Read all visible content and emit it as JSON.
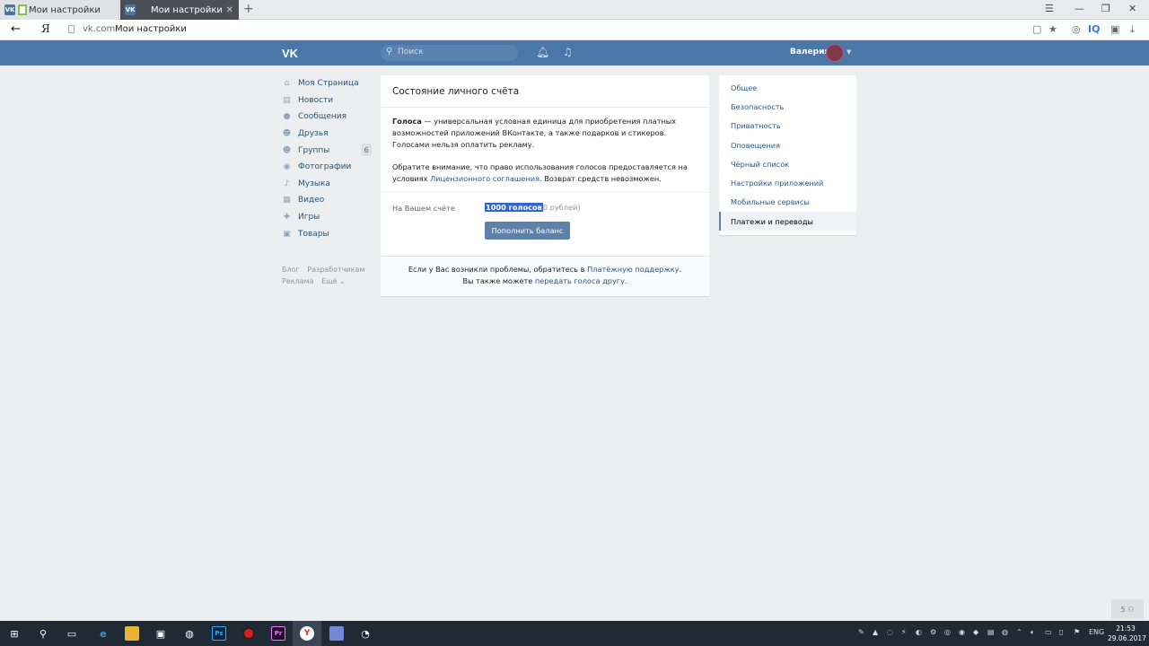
{
  "browser": {
    "tabs": [
      {
        "label": "Мои настройки",
        "favicon": "vk-favicon"
      },
      {
        "label": "Мои настройки",
        "favicon": "vk-favicon"
      }
    ],
    "close_glyph": "✕",
    "new_tab_glyph": "+",
    "address": {
      "host": "vk.com",
      "title": "Мои настройки"
    },
    "back_glyph": "←",
    "yandex_glyph": "Я",
    "iq_label": "IQ"
  },
  "header": {
    "logo": "VK",
    "search_placeholder": "Поиск",
    "user_name": "Валерия",
    "accent": "#4a76a8"
  },
  "sidebar": {
    "items": [
      {
        "label": "Моя Страница",
        "icon": "home-icon"
      },
      {
        "label": "Новости",
        "icon": "news-icon"
      },
      {
        "label": "Сообщения",
        "icon": "messages-icon"
      },
      {
        "label": "Друзья",
        "icon": "friends-icon"
      },
      {
        "label": "Группы",
        "icon": "groups-icon",
        "badge": "6"
      },
      {
        "label": "Фотографии",
        "icon": "camera-icon"
      },
      {
        "label": "Музыка",
        "icon": "music-icon"
      },
      {
        "label": "Видео",
        "icon": "video-icon"
      },
      {
        "label": "Игры",
        "icon": "games-icon"
      },
      {
        "label": "Товары",
        "icon": "market-icon"
      }
    ],
    "footer": {
      "blog": "Блог",
      "developers": "Разработчикам",
      "ads": "Реклама",
      "more": "Ещё ⌄"
    }
  },
  "main": {
    "title": "Состояние личного счёта",
    "desc1_bold": "Голоса",
    "desc1_rest": " — универсальная условная единица для приобретения платных возможностей приложений ВКонтакте, а также подарков и стикеров. Голосами нельзя оплатить рекламу.",
    "desc2_start": "Обратите внимание, что право использования голосов предоставляется на условиях ",
    "desc2_link": "Лицензионного соглашения",
    "desc2_end": ". Возврат средств невозможен.",
    "balance_label": "На Вашем счёте",
    "balance_votes": "1000 голосов",
    "balance_rub": "0 рублей)",
    "topup_button": "Пополнить баланс",
    "footer_line1_start": "Если у Вас возникли проблемы, обратитесь в ",
    "footer_line1_link": "Платёжную поддержку",
    "footer_line1_end": ".",
    "footer_line2_start": "Вы также можете ",
    "footer_line2_link": "передать голоса другу",
    "footer_line2_end": "."
  },
  "settings_menu": {
    "items": [
      {
        "label": "Общее",
        "active": false
      },
      {
        "label": "Безопасность",
        "active": false
      },
      {
        "label": "Приватность",
        "active": false
      },
      {
        "label": "Оповещения",
        "active": false
      },
      {
        "label": "Чёрный список",
        "active": false
      },
      {
        "label": "Настройки приложений",
        "active": false
      },
      {
        "label": "Мобильные сервисы",
        "active": false
      },
      {
        "label": "Платежи и переводы",
        "active": true
      }
    ]
  },
  "scroll_button": "5 ⚇",
  "taskbar": {
    "apps": [
      "windows-start-icon",
      "search-icon",
      "task-view-icon",
      "edge-icon",
      "file-explorer-icon",
      "store-icon",
      "steam-icon",
      "photoshop-icon",
      "obs-icon",
      "premiere-icon",
      "yandex-browser-icon",
      "discord-icon",
      "chrome-icon"
    ],
    "ps_label": "Ps",
    "pr_label": "Pr",
    "ya_label": "Y",
    "lang": "ENG",
    "time": "21:53",
    "date": "29.06.2017"
  }
}
